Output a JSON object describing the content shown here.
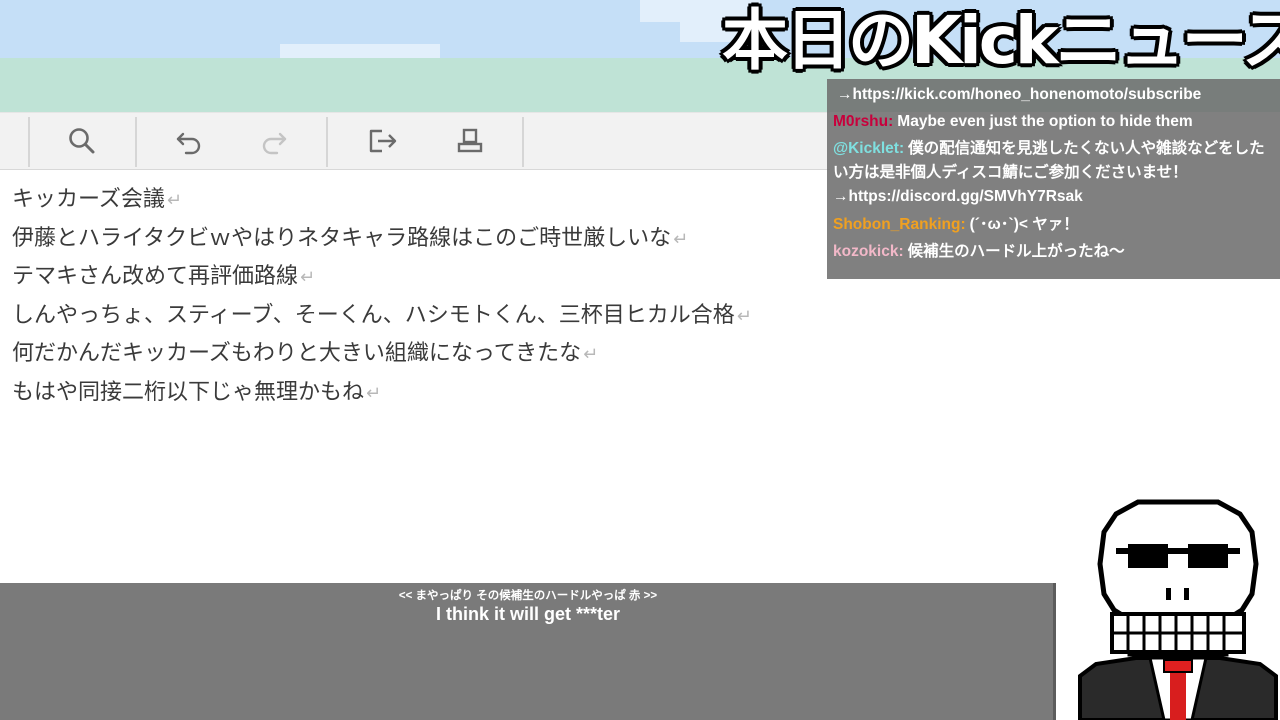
{
  "title": "本日のKickニュース",
  "toolbar": {
    "buttons": [
      {
        "icon": "search-icon"
      },
      {
        "icon": "undo-icon"
      },
      {
        "icon": "redo-icon"
      },
      {
        "icon": "export-icon"
      },
      {
        "icon": "stamp-icon"
      }
    ]
  },
  "editor": {
    "return_mark": "↵",
    "lines": [
      "キッカーズ会議",
      "伊藤とハライタクビｗやはりネタキャラ路線はこのご時世厳しいな",
      "テマキさん改めて再評価路線",
      "しんやっちょ、スティーブ、そーくん、ハシモトくん、三杯目ヒカル合格",
      "何だかんだキッカーズもわりと大きい組織になってきたな",
      "もはや同接二桁以下じゃ無理かもね"
    ]
  },
  "chat": {
    "messages": [
      {
        "user": "",
        "text": "→https://kick.com/honeo_honenomoto/subscribe",
        "color": "#ffffff"
      },
      {
        "user": "M0rshu:",
        "text": "Maybe even just the option to hide them",
        "color": "#c8003c"
      },
      {
        "user": "@Kicklet:",
        "text": "僕の配信通知を見逃したくない人や雑談などをしたい方は是非個人ディスコ鯖にご参加くださいませ！ →https://discord.gg/SMVhY7Rsak",
        "color": "#7fe0e0"
      },
      {
        "user": "Shobon_Ranking:",
        "text": "(´･ω･`)< ヤァ！",
        "color": "#f0a020"
      },
      {
        "user": "kozokick:",
        "text": "候補生のハードル上がったね〜",
        "color": "#f2b8c8"
      }
    ]
  },
  "subtitles": {
    "japanese": "<< まやっぱり その候補生のハードルやっぱ 赤 >>",
    "english": "I think it will get ***ter"
  },
  "colors": {
    "sky": "#c5dff7",
    "band": "#bfe3d6",
    "toolbar": "#f2f2f2",
    "chat_bg": "#6e6e6e",
    "subtitle_bg": "#7a7a7a"
  }
}
